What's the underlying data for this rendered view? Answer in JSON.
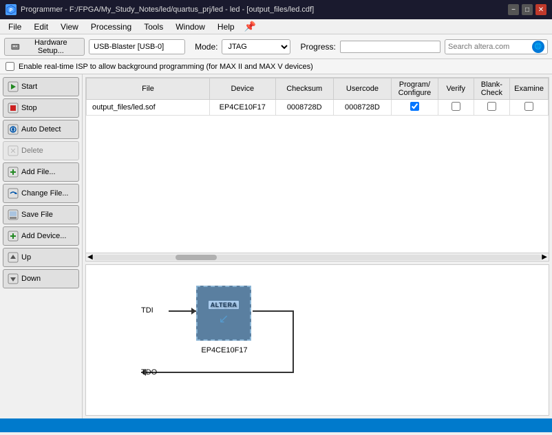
{
  "titlebar": {
    "icon": "P",
    "title": "Programmer - F:/FPGA/My_Study_Notes/led/quartus_prj/led - led - [output_files/led.cdf]",
    "controls": {
      "minimize": "−",
      "maximize": "□",
      "close": "✕"
    }
  },
  "menubar": {
    "items": [
      "File",
      "Edit",
      "View",
      "Processing",
      "Tools",
      "Window",
      "Help"
    ]
  },
  "toolbar": {
    "hw_setup_label": "Hardware Setup...",
    "usb_blaster": "USB-Blaster [USB-0]",
    "mode_label": "Mode:",
    "mode_value": "JTAG",
    "progress_label": "Progress:",
    "search_placeholder": "Search altera.com"
  },
  "isp_checkbox": {
    "label": "Enable real-time ISP to allow background programming (for MAX II and MAX V devices)"
  },
  "sidebar": {
    "buttons": [
      {
        "id": "start",
        "label": "Start",
        "enabled": true
      },
      {
        "id": "stop",
        "label": "Stop",
        "enabled": true
      },
      {
        "id": "auto-detect",
        "label": "Auto Detect",
        "enabled": true
      },
      {
        "id": "delete",
        "label": "Delete",
        "enabled": false
      },
      {
        "id": "add-file",
        "label": "Add File...",
        "enabled": true
      },
      {
        "id": "change-file",
        "label": "Change File...",
        "enabled": true
      },
      {
        "id": "save-file",
        "label": "Save File",
        "enabled": true
      },
      {
        "id": "add-device",
        "label": "Add Device...",
        "enabled": true
      },
      {
        "id": "up",
        "label": "Up",
        "enabled": true
      },
      {
        "id": "down",
        "label": "Down",
        "enabled": true
      }
    ]
  },
  "table": {
    "headers": [
      "File",
      "Device",
      "Checksum",
      "Usercode",
      "Program/Configure",
      "Verify",
      "Blank-Check",
      "Examine"
    ],
    "rows": [
      {
        "file": "output_files/led.sof",
        "device": "EP4CE10F17",
        "checksum": "0008728D",
        "usercode": "0008728D",
        "program": true,
        "verify": false,
        "blank_check": false,
        "examine": false
      }
    ]
  },
  "diagram": {
    "tdi_label": "TDI",
    "tdo_label": "TDO",
    "chip_logo": "ALTERA",
    "device_name": "EP4CE10F17"
  },
  "statusbar": {
    "text": ""
  }
}
